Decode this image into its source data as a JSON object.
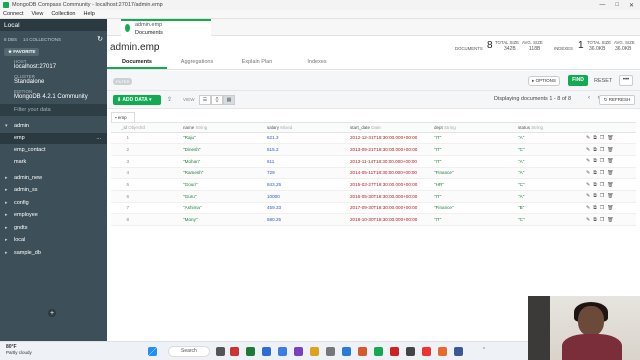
{
  "window": {
    "title": "MongoDB Compass Community - localhost:27017/admin.emp",
    "controls": [
      "—",
      "□",
      "✕"
    ]
  },
  "menu": [
    "Connect",
    "View",
    "Collection",
    "Help"
  ],
  "sidebar": {
    "header": "Local",
    "dbs_count": "8 DBS",
    "collections_count": "14 COLLECTIONS",
    "favorite_label": "FAVORITE",
    "host_label": "HOST",
    "host_value": "localhost:27017",
    "cluster_label": "CLUSTER",
    "cluster_value": "Standalone",
    "edition_label": "EDITION",
    "edition_value": "MongoDB 4.2.1 Community",
    "filter_placeholder": "Filter your data",
    "databases": [
      {
        "name": "admin",
        "expanded": true,
        "collections": [
          "emp",
          "emp_contact",
          "mark"
        ]
      },
      {
        "name": "admin_new"
      },
      {
        "name": "admin_ss"
      },
      {
        "name": "config"
      },
      {
        "name": "employee"
      },
      {
        "name": "gndts"
      },
      {
        "name": "local"
      },
      {
        "name": "sample_db"
      }
    ],
    "active_collection_dots": "..."
  },
  "tab": {
    "db_coll": "admin.emp",
    "sub": "Documents"
  },
  "namespace": {
    "db": "admin",
    "coll": ".emp"
  },
  "stats": {
    "documents_label": "DOCUMENTS",
    "documents_count": "8",
    "total_size_label": "TOTAL SIZE",
    "total_size": "342B",
    "avg_size_label": "AVG. SIZE",
    "avg_size": "118B",
    "indexes_label": "INDEXES",
    "indexes_count": "1",
    "idx_total_size_label": "TOTAL SIZE",
    "idx_total_size": "36.0KB",
    "idx_avg_size_label": "AVG. SIZE",
    "idx_avg_size": "36.0KB"
  },
  "subtabs": [
    "Documents",
    "Aggregations",
    "Explain Plan",
    "Indexes"
  ],
  "query": {
    "filter_pill": "FILTER",
    "options": "▸ OPTIONS",
    "find": "FIND",
    "reset": "RESET",
    "more": "•••"
  },
  "toolbar": {
    "add_data": "ADD DATA ▾",
    "view_label": "VIEW",
    "displaying": "Displaying documents 1 - 8 of 8",
    "pager": "‹ ›",
    "refresh": "↻ REFRESH"
  },
  "table": {
    "tab_label": "emp",
    "columns": [
      {
        "name": "_id",
        "type": "ObjectId"
      },
      {
        "name": "name",
        "type": "String"
      },
      {
        "name": "salary",
        "type": "Mixed"
      },
      {
        "name": "start_date",
        "type": "Date"
      },
      {
        "name": "dept",
        "type": "String"
      },
      {
        "name": "status",
        "type": "String"
      }
    ],
    "rows": [
      {
        "n": "1",
        "name": "\"Raju\"",
        "salary": "621.3",
        "start_date": "2012-12-31T18:30:00.000+00:00",
        "dept": "\"IT\"",
        "status": "\"A\""
      },
      {
        "n": "2",
        "name": "\"Dinesh\"",
        "salary": "515.2",
        "start_date": "2013-09-21T18:30:00.000+00:00",
        "dept": "\"IT\"",
        "status": "\"C\""
      },
      {
        "n": "3",
        "name": "\"Mohan\"",
        "salary": "611",
        "start_date": "2013-11-14T18:30:00.000+00:00",
        "dept": "\"IT\"",
        "status": "\"A\""
      },
      {
        "n": "4",
        "name": "\"Ramesh\"",
        "salary": "729",
        "start_date": "2014-05-11T18:30:00.000+00:00",
        "dept": "\"Finance\"",
        "status": "\"A\""
      },
      {
        "n": "5",
        "name": "\"Gouri\"",
        "salary": "843.25",
        "start_date": "2015-03-27T18:30:00.000+00:00",
        "dept": "\"HR\"",
        "status": "\"C\""
      },
      {
        "n": "6",
        "name": "\"Guru\"",
        "salary": "10000",
        "start_date": "2016-05-30T18:30:00.000+00:00",
        "dept": "\"IT\"",
        "status": "\"A\""
      },
      {
        "n": "7",
        "name": "\"Ashima\"",
        "salary": "459.33",
        "start_date": "2017-09-30T18:30:00.000+00:00",
        "dept": "\"Finance\"",
        "status": "\"B\""
      },
      {
        "n": "8",
        "name": "\"Mony\"",
        "salary": "580.25",
        "start_date": "2018-10-30T18:30:00.000+00:00",
        "dept": "\"IT\"",
        "status": "\"C\""
      }
    ],
    "row_actions": [
      "✎",
      "⧉",
      "❐",
      "🗑"
    ]
  },
  "taskbar": {
    "temp": "80°F",
    "weather": "Partly cloudy",
    "search": "Search",
    "time": "ENG"
  },
  "colors": {
    "accent": "#13aa52",
    "sidebar": "#3d4f58",
    "sidebar_dark": "#2b3a41"
  }
}
